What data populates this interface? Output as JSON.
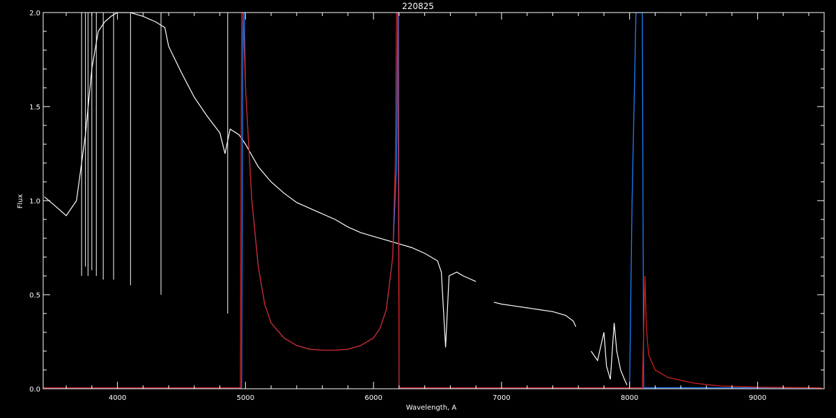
{
  "chart_data": {
    "type": "line",
    "title": "220825",
    "xlabel": "Wavelength, A",
    "ylabel": "Flux",
    "xlim": [
      3420,
      9520
    ],
    "ylim": [
      0.0,
      2.0
    ],
    "x_ticks": [
      4000,
      5000,
      6000,
      7000,
      8000,
      9000
    ],
    "x_tick_labels": [
      "4000",
      "5000",
      "6000",
      "7000",
      "8000",
      "9000"
    ],
    "y_ticks": [
      0.0,
      0.5,
      1.0,
      1.5,
      2.0
    ],
    "y_tick_labels": [
      "0.0",
      "0.5",
      "1.0",
      "1.5",
      "2.0"
    ],
    "grid": false,
    "colors": {
      "background": "#000000",
      "axes": "#ffffff",
      "spectrum": "#ffffff",
      "blue_curve": "#1e7fff",
      "red_curve": "#d02020"
    },
    "series": [
      {
        "color": "white",
        "segments": [
          {
            "x": [
              3430,
              3500,
              3600,
              3680,
              3750,
              3800,
              3850,
              3900,
              3950,
              4000,
              4100,
              4200,
              4300,
              4370,
              4400,
              4500,
              4600,
              4700,
              4800,
              4840,
              4880,
              4950,
              5000,
              5100,
              5200,
              5300,
              5400,
              5500,
              5600,
              5700,
              5800,
              5900,
              6000,
              6100,
              6200,
              6300,
              6400,
              6500,
              6530,
              6563,
              6590,
              6650,
              6700,
              6800
            ],
            "y": [
              1.02,
              0.98,
              0.92,
              1.0,
              1.35,
              1.7,
              1.9,
              1.95,
              1.98,
              2.0,
              2.0,
              1.98,
              1.95,
              1.92,
              1.82,
              1.68,
              1.55,
              1.45,
              1.36,
              1.25,
              1.38,
              1.35,
              1.3,
              1.18,
              1.1,
              1.04,
              0.99,
              0.96,
              0.93,
              0.9,
              0.86,
              0.83,
              0.81,
              0.79,
              0.77,
              0.75,
              0.72,
              0.68,
              0.62,
              0.22,
              0.6,
              0.62,
              0.6,
              0.57
            ]
          },
          {
            "x": [
              6940,
              7000,
              7100,
              7200,
              7300,
              7400,
              7500,
              7560,
              7580
            ],
            "y": [
              0.46,
              0.45,
              0.44,
              0.43,
              0.42,
              0.41,
              0.39,
              0.36,
              0.33
            ]
          },
          {
            "x": [
              7700,
              7750,
              7800,
              7820,
              7850,
              7880,
              7900,
              7930,
              7960,
              7980
            ],
            "y": [
              0.2,
              0.15,
              0.3,
              0.12,
              0.05,
              0.35,
              0.2,
              0.1,
              0.05,
              0.02
            ]
          }
        ],
        "absorption_lines": [
          {
            "x": 3720,
            "y": 0.6
          },
          {
            "x": 3750,
            "y": 0.65
          },
          {
            "x": 3770,
            "y": 0.6
          },
          {
            "x": 3800,
            "y": 0.63
          },
          {
            "x": 3835,
            "y": 0.6
          },
          {
            "x": 3889,
            "y": 0.58
          },
          {
            "x": 3970,
            "y": 0.58
          },
          {
            "x": 4102,
            "y": 0.55
          },
          {
            "x": 4340,
            "y": 0.5
          },
          {
            "x": 4861,
            "y": 0.4
          }
        ]
      },
      {
        "color": "blue",
        "x": [
          3420,
          4970,
          4980,
          4990,
          5000,
          5050,
          5100,
          5150,
          5200,
          5300,
          5400,
          5500,
          5600,
          5700,
          5800,
          5900,
          6000,
          6050,
          6100,
          6150,
          6180,
          6190,
          6195,
          6200,
          6210,
          8000,
          8020,
          8050,
          8080,
          8100,
          8110,
          8120,
          8140,
          8200,
          8300,
          9500
        ],
        "y": [
          0.005,
          0.005,
          2.0,
          2.0,
          1.6,
          1.0,
          0.65,
          0.45,
          0.35,
          0.27,
          0.23,
          0.21,
          0.205,
          0.205,
          0.21,
          0.23,
          0.27,
          0.32,
          0.42,
          0.7,
          1.2,
          2.0,
          2.0,
          0.005,
          0.005,
          0.005,
          1.0,
          2.0,
          2.0,
          2.0,
          0.005,
          0.005,
          0.005,
          0.005,
          0.005,
          0.005
        ]
      },
      {
        "color": "red",
        "x": [
          3420,
          4960,
          4970,
          4980,
          5000,
          5050,
          5100,
          5150,
          5200,
          5300,
          5400,
          5500,
          5600,
          5700,
          5800,
          5900,
          6000,
          6050,
          6100,
          6150,
          6170,
          6180,
          6190,
          6200,
          8100,
          8120,
          8130,
          8140,
          8150,
          8200,
          8300,
          8500,
          8700,
          9000,
          9500
        ],
        "y": [
          0.005,
          0.005,
          2.0,
          2.0,
          1.6,
          1.0,
          0.65,
          0.45,
          0.35,
          0.27,
          0.23,
          0.21,
          0.205,
          0.205,
          0.21,
          0.23,
          0.27,
          0.32,
          0.42,
          0.7,
          1.2,
          2.0,
          2.0,
          0.005,
          0.005,
          0.6,
          0.35,
          0.25,
          0.18,
          0.1,
          0.06,
          0.03,
          0.015,
          0.008,
          0.005
        ]
      }
    ]
  }
}
